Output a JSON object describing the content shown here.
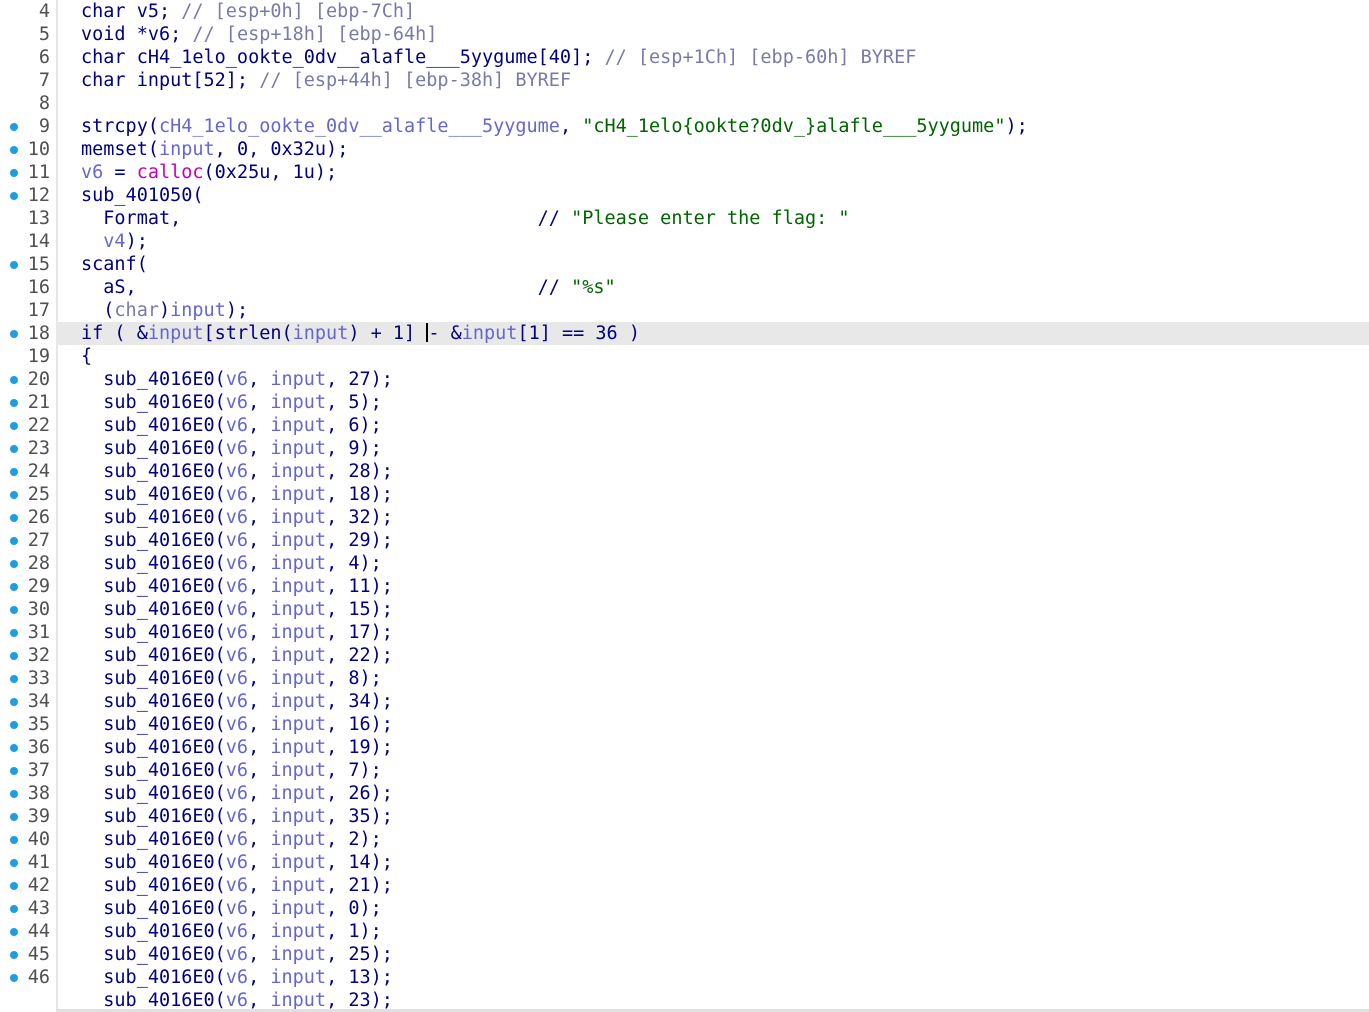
{
  "editor": {
    "lines": [
      {
        "n": "4",
        "bp": false,
        "hl": false,
        "html": "char v5; <span class='cm'>// [esp+0h] [ebp-7Ch]</span>"
      },
      {
        "n": "5",
        "bp": false,
        "hl": false,
        "html": "void *v6; <span class='cm'>// [esp+18h] [ebp-64h]</span>"
      },
      {
        "n": "6",
        "bp": false,
        "hl": false,
        "html": "char cH4_1elo_ookte_0dv__alafle___5yygume[40]; <span class='cm'>// [esp+1Ch] [ebp-60h] BYREF</span>"
      },
      {
        "n": "7",
        "bp": false,
        "hl": false,
        "html": "char input[52]; <span class='cm'>// [esp+44h] [ebp-38h] BYREF</span>"
      },
      {
        "n": "8",
        "bp": false,
        "hl": false,
        "html": ""
      },
      {
        "n": "9",
        "bp": true,
        "hl": false,
        "html": "strcpy(<span class='var'>cH4_1elo_ookte_0dv__alafle___5yygume</span>, <span class='str'>\"cH4_1elo{ookte?0dv_}alafle___5yygume\"</span>);"
      },
      {
        "n": "10",
        "bp": true,
        "hl": false,
        "html": "memset(<span class='var'>input</span>, 0, 0x32u);"
      },
      {
        "n": "11",
        "bp": true,
        "hl": false,
        "html": "<span class='var'>v6</span> = <span class='fnp'>calloc</span>(0x25u, 1u);"
      },
      {
        "n": "12",
        "bp": true,
        "hl": false,
        "html": "sub_401050("
      },
      {
        "n": "13",
        "bp": false,
        "hl": false,
        "html": "  Format,                                // <span class='cmg'>\"Please enter the flag: \"</span>"
      },
      {
        "n": "14",
        "bp": false,
        "hl": false,
        "html": "  <span class='var'>v4</span>);"
      },
      {
        "n": "15",
        "bp": true,
        "hl": false,
        "html": "scanf("
      },
      {
        "n": "16",
        "bp": false,
        "hl": false,
        "html": "  aS,                                    // <span class='cmg'>\"%s\"</span>"
      },
      {
        "n": "17",
        "bp": false,
        "hl": false,
        "html": "  (<span class='cm'>char</span>)<span class='var'>input</span>);"
      },
      {
        "n": "18",
        "bp": true,
        "hl": true,
        "html": "if ( &amp;<span class='var'>input</span>[strlen(<span class='var'>input</span>) + 1] <span class='caret'></span>- &amp;<span class='var'>input</span>[1] == 36 )"
      },
      {
        "n": "19",
        "bp": false,
        "hl": false,
        "html": "{"
      },
      {
        "n": "20",
        "bp": true,
        "hl": false,
        "html": "  sub_4016E0(<span class='var'>v6</span>, <span class='var'>input</span>, 27);"
      },
      {
        "n": "21",
        "bp": true,
        "hl": false,
        "html": "  sub_4016E0(<span class='var'>v6</span>, <span class='var'>input</span>, 5);"
      },
      {
        "n": "22",
        "bp": true,
        "hl": false,
        "html": "  sub_4016E0(<span class='var'>v6</span>, <span class='var'>input</span>, 6);"
      },
      {
        "n": "23",
        "bp": true,
        "hl": false,
        "html": "  sub_4016E0(<span class='var'>v6</span>, <span class='var'>input</span>, 9);"
      },
      {
        "n": "24",
        "bp": true,
        "hl": false,
        "html": "  sub_4016E0(<span class='var'>v6</span>, <span class='var'>input</span>, 28);"
      },
      {
        "n": "25",
        "bp": true,
        "hl": false,
        "html": "  sub_4016E0(<span class='var'>v6</span>, <span class='var'>input</span>, 18);"
      },
      {
        "n": "26",
        "bp": true,
        "hl": false,
        "html": "  sub_4016E0(<span class='var'>v6</span>, <span class='var'>input</span>, 32);"
      },
      {
        "n": "27",
        "bp": true,
        "hl": false,
        "html": "  sub_4016E0(<span class='var'>v6</span>, <span class='var'>input</span>, 29);"
      },
      {
        "n": "28",
        "bp": true,
        "hl": false,
        "html": "  sub_4016E0(<span class='var'>v6</span>, <span class='var'>input</span>, 4);"
      },
      {
        "n": "29",
        "bp": true,
        "hl": false,
        "html": "  sub_4016E0(<span class='var'>v6</span>, <span class='var'>input</span>, 11);"
      },
      {
        "n": "30",
        "bp": true,
        "hl": false,
        "html": "  sub_4016E0(<span class='var'>v6</span>, <span class='var'>input</span>, 15);"
      },
      {
        "n": "31",
        "bp": true,
        "hl": false,
        "html": "  sub_4016E0(<span class='var'>v6</span>, <span class='var'>input</span>, 17);"
      },
      {
        "n": "32",
        "bp": true,
        "hl": false,
        "html": "  sub_4016E0(<span class='var'>v6</span>, <span class='var'>input</span>, 22);"
      },
      {
        "n": "33",
        "bp": true,
        "hl": false,
        "html": "  sub_4016E0(<span class='var'>v6</span>, <span class='var'>input</span>, 8);"
      },
      {
        "n": "34",
        "bp": true,
        "hl": false,
        "html": "  sub_4016E0(<span class='var'>v6</span>, <span class='var'>input</span>, 34);"
      },
      {
        "n": "35",
        "bp": true,
        "hl": false,
        "html": "  sub_4016E0(<span class='var'>v6</span>, <span class='var'>input</span>, 16);"
      },
      {
        "n": "36",
        "bp": true,
        "hl": false,
        "html": "  sub_4016E0(<span class='var'>v6</span>, <span class='var'>input</span>, 19);"
      },
      {
        "n": "37",
        "bp": true,
        "hl": false,
        "html": "  sub_4016E0(<span class='var'>v6</span>, <span class='var'>input</span>, 7);"
      },
      {
        "n": "38",
        "bp": true,
        "hl": false,
        "html": "  sub_4016E0(<span class='var'>v6</span>, <span class='var'>input</span>, 26);"
      },
      {
        "n": "39",
        "bp": true,
        "hl": false,
        "html": "  sub_4016E0(<span class='var'>v6</span>, <span class='var'>input</span>, 35);"
      },
      {
        "n": "40",
        "bp": true,
        "hl": false,
        "html": "  sub_4016E0(<span class='var'>v6</span>, <span class='var'>input</span>, 2);"
      },
      {
        "n": "41",
        "bp": true,
        "hl": false,
        "html": "  sub_4016E0(<span class='var'>v6</span>, <span class='var'>input</span>, 14);"
      },
      {
        "n": "42",
        "bp": true,
        "hl": false,
        "html": "  sub_4016E0(<span class='var'>v6</span>, <span class='var'>input</span>, 21);"
      },
      {
        "n": "43",
        "bp": true,
        "hl": false,
        "html": "  sub_4016E0(<span class='var'>v6</span>, <span class='var'>input</span>, 0);"
      },
      {
        "n": "44",
        "bp": true,
        "hl": false,
        "html": "  sub_4016E0(<span class='var'>v6</span>, <span class='var'>input</span>, 1);"
      },
      {
        "n": "45",
        "bp": true,
        "hl": false,
        "html": "  sub_4016E0(<span class='var'>v6</span>, <span class='var'>input</span>, 25);"
      },
      {
        "n": "46",
        "bp": true,
        "hl": false,
        "html": "  sub_4016E0(<span class='var'>v6</span>, <span class='var'>input</span>, 13);"
      },
      {
        "n": "",
        "bp": false,
        "hl": false,
        "html": "  sub_4016E0(<span class='var'>v6</span>, <span class='var'>input</span>, 23);"
      }
    ]
  }
}
